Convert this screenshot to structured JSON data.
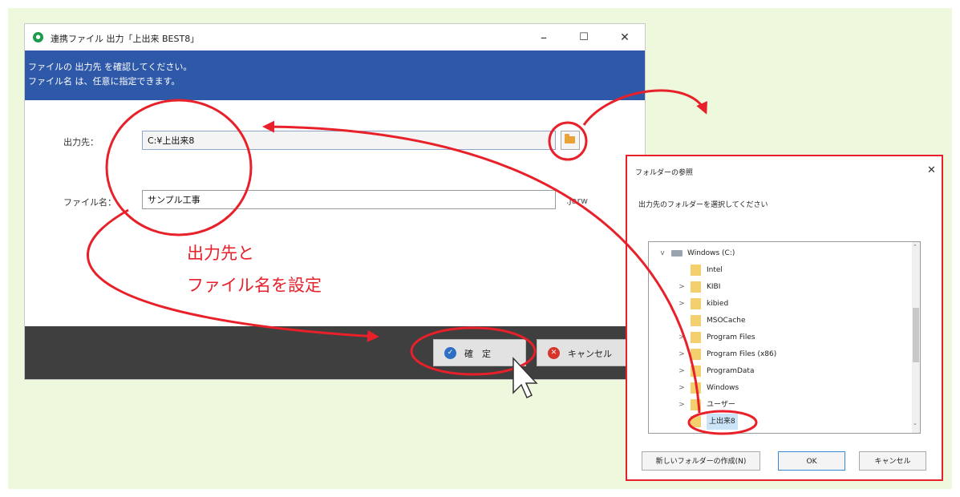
{
  "main_dialog": {
    "title": "連携ファイル 出力「上出来 BEST8」",
    "header_line1": "ファイルの 出力先 を確認してください。",
    "header_line2": "ファイル名 は、任意に指定できます。",
    "dest_label": "出力先：",
    "dest_value": "C:¥上出来8",
    "filename_label": "ファイル名：",
    "filename_value": "サンプル工事",
    "extension": ".Jarw",
    "confirm_label": "確　定",
    "cancel_label": "キャンセル",
    "minimize": "–",
    "maximize": "☐",
    "close": "✕"
  },
  "annotation": {
    "line1": "出力先と",
    "line2": "ファイル名を設定"
  },
  "browse_dialog": {
    "title": "フォルダーの参照",
    "close": "✕",
    "message": "出力先のフォルダーを選択してください",
    "tree": [
      {
        "label": "Windows (C:)",
        "expand": "v",
        "level": 0,
        "drive": true
      },
      {
        "label": "Intel",
        "expand": "",
        "level": 1
      },
      {
        "label": "KIBI",
        "expand": ">",
        "level": 1
      },
      {
        "label": "kibied",
        "expand": ">",
        "level": 1
      },
      {
        "label": "MSOCache",
        "expand": "",
        "level": 1
      },
      {
        "label": "Program Files",
        "expand": ">",
        "level": 1
      },
      {
        "label": "Program Files (x86)",
        "expand": ">",
        "level": 1
      },
      {
        "label": "ProgramData",
        "expand": ">",
        "level": 1
      },
      {
        "label": "Windows",
        "expand": ">",
        "level": 1
      },
      {
        "label": "ユーザー",
        "expand": ">",
        "level": 1
      },
      {
        "label": "上出来8",
        "expand": "",
        "level": 1,
        "selected": true
      }
    ],
    "new_folder_label": "新しいフォルダーの作成(N)",
    "ok_label": "OK",
    "cancel_label": "キャンセル"
  },
  "colors": {
    "header_blue": "#2e58a8",
    "annotation_red": "#e8202a",
    "background_green": "#eef8dc"
  }
}
